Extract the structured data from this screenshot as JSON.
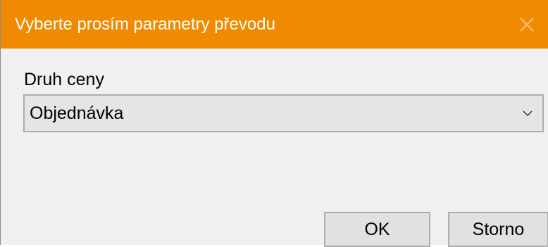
{
  "dialog": {
    "title": "Vyberte prosím parametry převodu",
    "close_icon": "close-icon"
  },
  "price_type": {
    "label": "Druh ceny",
    "selected_value": "Objednávka",
    "dropdown_icon": "chevron-down-icon"
  },
  "buttons": {
    "ok_label": "OK",
    "cancel_label": "Storno"
  },
  "colors": {
    "title_bar": "#f08a00",
    "title_text": "#ffffff",
    "dialog_background": "#f0f0f0",
    "select_background": "#e5e5e5",
    "button_background": "#e1e1e1",
    "border": "#adadad"
  }
}
